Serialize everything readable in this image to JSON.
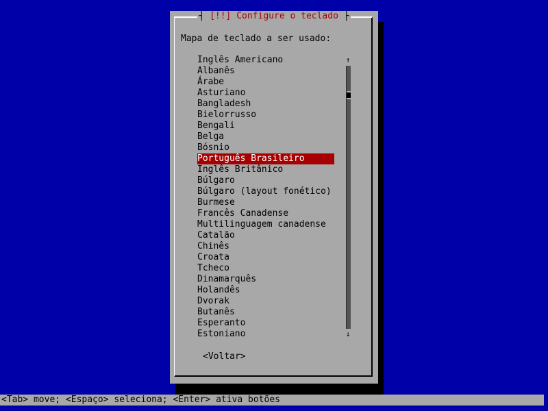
{
  "dialog": {
    "alert_marker": "[!!]",
    "title": "Configure o teclado",
    "prompt": "Mapa de teclado a ser usado:",
    "back_button": "<Voltar>"
  },
  "keymaps": [
    "Inglês Americano",
    "Albanês",
    "Árabe",
    "Asturiano",
    "Bangladesh",
    "Bielorrusso",
    "Bengali",
    "Belga",
    "Bósnio",
    "Português Brasileiro",
    "Inglês Britânico",
    "Búlgaro",
    "Búlgaro (layout fonético)",
    "Burmese",
    "Francês Canadense",
    "Multilinguagem canadense",
    "Catalão",
    "Chinês",
    "Croata",
    "Tcheco",
    "Dinamarquês",
    "Holandês",
    "Dvorak",
    "Butanês",
    "Esperanto",
    "Estoniano"
  ],
  "selected_keymap": "Português Brasileiro",
  "scrollbar": {
    "up_arrow": "↑",
    "down_arrow": "↓",
    "position_fraction": 0.1
  },
  "status_bar": "<Tab> move; <Espaço> seleciona; <Enter> ativa botões",
  "colors": {
    "background": "#0000a8",
    "dialog": "#a8a8a8",
    "title": "#a80000",
    "selection": "#a80000",
    "selection_text": "#ffffff"
  }
}
